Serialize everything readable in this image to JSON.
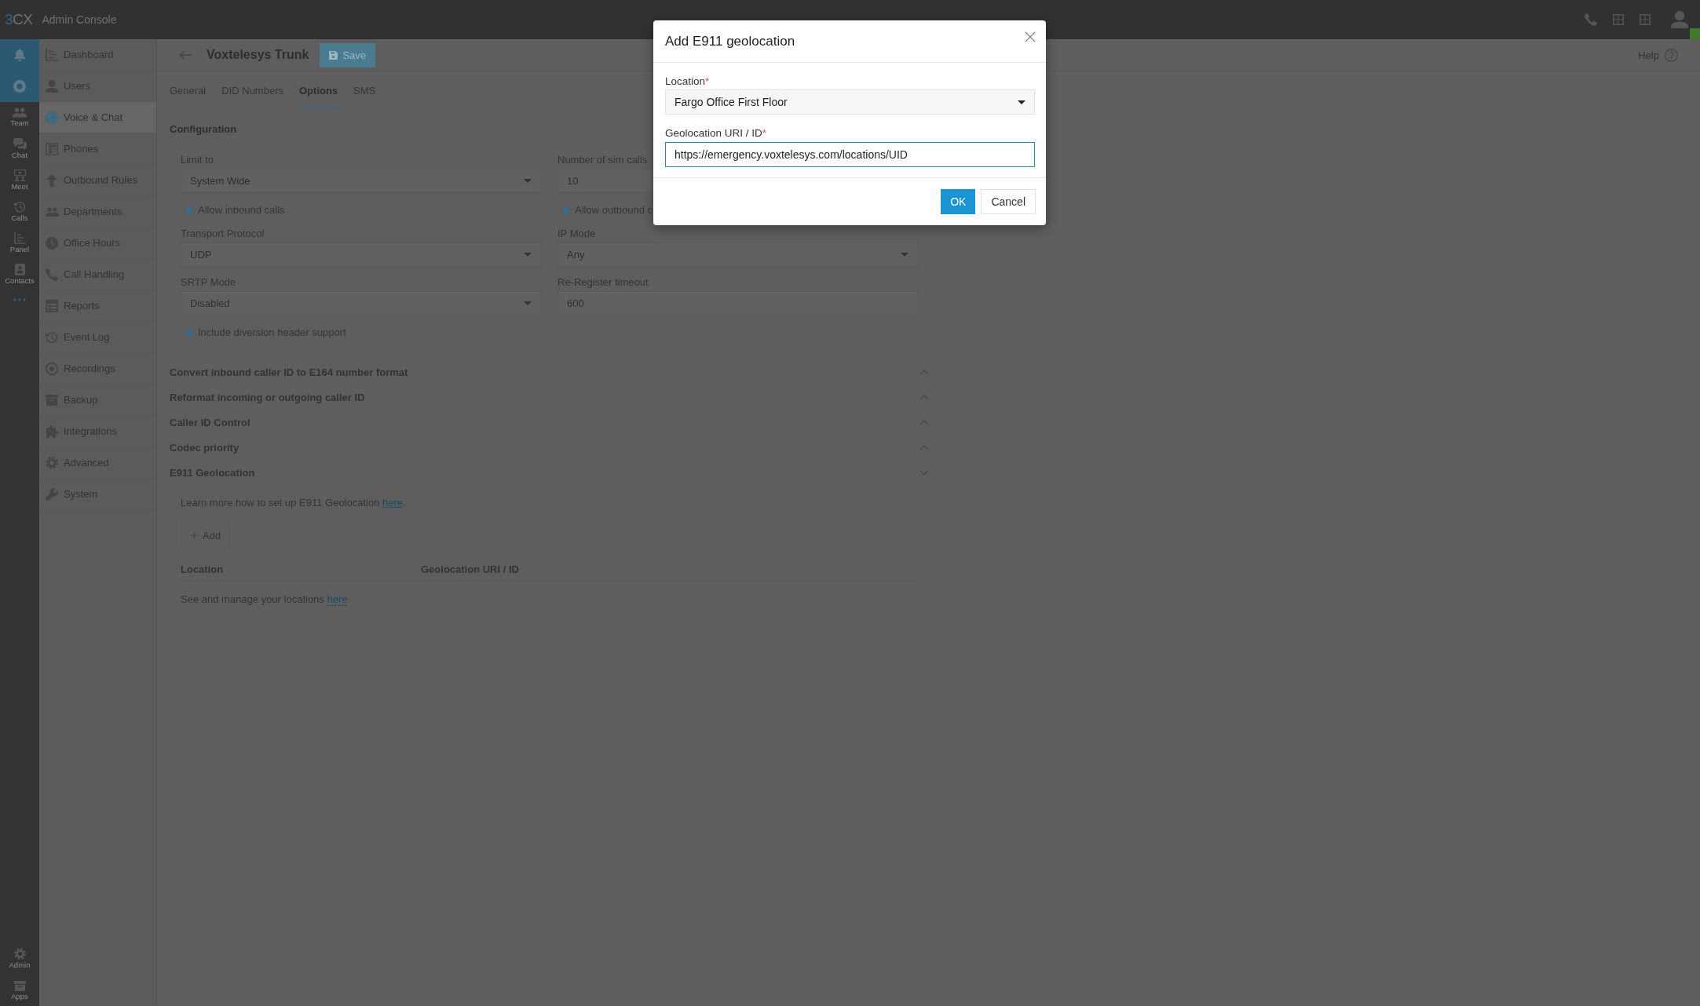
{
  "top_bar": {
    "logo": {
      "mark": "3",
      "text": "CX"
    },
    "title": "Admin Console"
  },
  "rail": {
    "items": [
      {
        "label": "Team"
      },
      {
        "label": "Chat"
      },
      {
        "label": "Meet"
      },
      {
        "label": "Calls"
      },
      {
        "label": "Panel"
      },
      {
        "label": "Contacts"
      }
    ],
    "bottom_items": [
      {
        "label": "Admin"
      },
      {
        "label": "Apps"
      }
    ]
  },
  "sidebar": {
    "items": [
      {
        "label": "Dashboard",
        "selected": false
      },
      {
        "label": "Users",
        "selected": false
      },
      {
        "label": "Voice & Chat",
        "selected": true
      },
      {
        "label": "Phones",
        "selected": false
      },
      {
        "label": "Outbound Rules",
        "selected": false
      },
      {
        "label": "Departments",
        "selected": false
      },
      {
        "label": "Office Hours",
        "selected": false
      },
      {
        "label": "Call Handling",
        "selected": false
      },
      {
        "label": "Reports",
        "selected": false
      },
      {
        "label": "Event Log",
        "selected": false
      },
      {
        "label": "Recordings",
        "selected": false
      },
      {
        "label": "Backup",
        "selected": false
      },
      {
        "label": "Integrations",
        "selected": false
      },
      {
        "label": "Advanced",
        "selected": false
      },
      {
        "label": "System",
        "selected": false
      }
    ]
  },
  "header": {
    "title": "Voxtelesys Trunk",
    "save_button": "Save",
    "help": "Help"
  },
  "tabs": [
    {
      "label": "General",
      "selected": false
    },
    {
      "label": "DID Numbers",
      "selected": false
    },
    {
      "label": "Options",
      "selected": true
    },
    {
      "label": "SMS",
      "selected": false
    }
  ],
  "configuration": {
    "title": "Configuration",
    "fields": [
      {
        "kind": "select",
        "label": "Limit to",
        "value": "System Wide"
      },
      {
        "kind": "input",
        "label": "Number of sim calls",
        "value": "10"
      },
      {
        "kind": "checkbox",
        "label": "Allow inbound calls",
        "checked": true
      },
      {
        "kind": "checkbox",
        "label": "Allow outbound c",
        "checked": true
      },
      {
        "kind": "select",
        "label": "Transport Protocol",
        "value": "UDP"
      },
      {
        "kind": "select",
        "label": "IP Mode",
        "value": "Any"
      },
      {
        "kind": "select",
        "label": "SRTP Mode",
        "value": "Disabled"
      },
      {
        "kind": "input",
        "label": "Re-Register timeout",
        "value": "600"
      },
      {
        "kind": "checkbox",
        "label": "Include diversion header support",
        "checked": true
      }
    ]
  },
  "sections": [
    {
      "title": "Convert inbound caller ID to E164 number format",
      "expanded": false
    },
    {
      "title": "Reformat incoming or outgoing caller ID",
      "expanded": false
    },
    {
      "title": "Caller ID Control",
      "expanded": false
    },
    {
      "title": "Codec priority",
      "expanded": false
    },
    {
      "title": "E911 Geolocation",
      "expanded": true,
      "body": {
        "intro": {
          "text": "Learn more how to set up E911 Geolocation",
          "link": "here",
          "after": "."
        },
        "add_button": "Add",
        "table": {
          "columns": [
            "Location",
            "Geolocation URI / ID"
          ],
          "empty": {
            "text": "See and manage your locations",
            "link": "here"
          }
        }
      }
    }
  ],
  "dialog": {
    "title": "Add E911 geolocation",
    "fields": [
      {
        "kind": "select",
        "label": "Location",
        "required_mark": "*",
        "value": "Fargo Office First Floor"
      },
      {
        "kind": "input",
        "label": "Geolocation URI / ID",
        "required_mark": "*",
        "value": "https://emergency.voxtelesys.com/locations/UID",
        "focused": true
      }
    ],
    "buttons": [
      {
        "label": "OK",
        "kind": "primary"
      },
      {
        "label": "Cancel",
        "kind": "secondary"
      }
    ]
  }
}
